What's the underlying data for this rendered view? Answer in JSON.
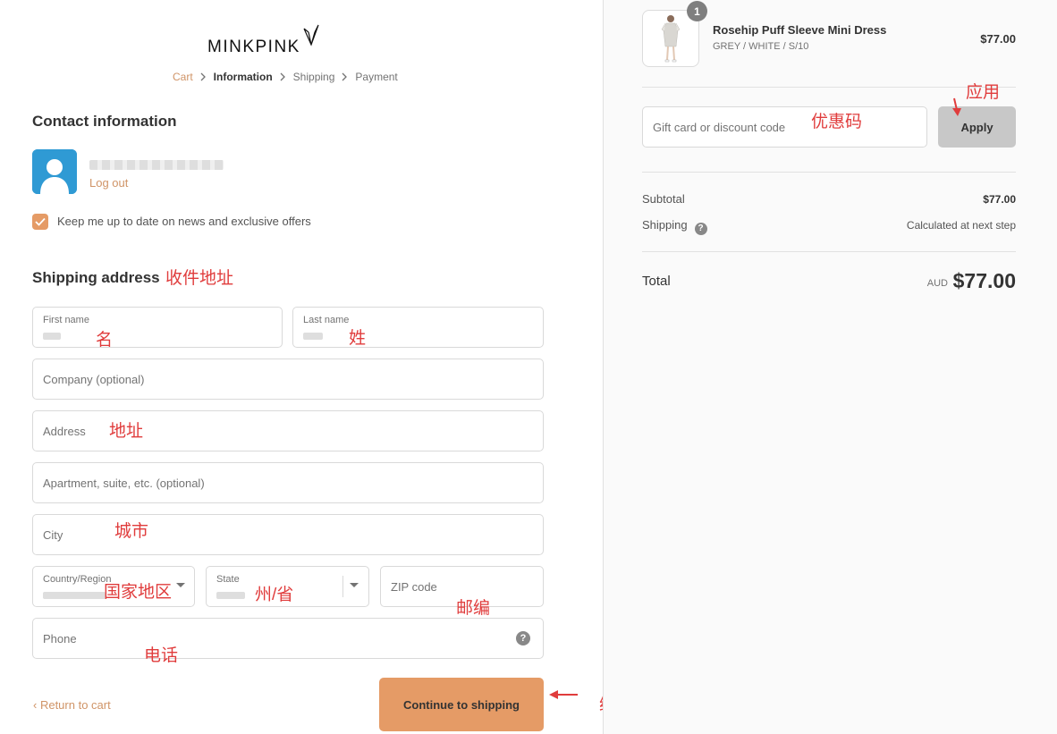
{
  "brand": {
    "name": "MINKPINK"
  },
  "breadcrumb": [
    {
      "label": "Cart"
    },
    {
      "label": "Information"
    },
    {
      "label": "Shipping"
    },
    {
      "label": "Payment"
    }
  ],
  "contact": {
    "title": "Contact information",
    "logout_label": "Log out",
    "newsletter_label": "Keep me up to date on news and exclusive offers",
    "newsletter_checked": true
  },
  "shipping": {
    "title": "Shipping address",
    "first_name_label": "First name",
    "last_name_label": "Last name",
    "company_placeholder": "Company (optional)",
    "address_placeholder": "Address",
    "apartment_placeholder": "Apartment, suite, etc. (optional)",
    "city_placeholder": "City",
    "country_label": "Country/Region",
    "state_label": "State",
    "zip_placeholder": "ZIP code",
    "phone_placeholder": "Phone"
  },
  "actions": {
    "return_label": "Return to cart",
    "continue_label": "Continue to shipping"
  },
  "annotations": {
    "shipping_address": "收件地址",
    "first_name": "名",
    "last_name": "姓",
    "address": "地址",
    "city": "城市",
    "country": "国家地区",
    "state": "州/省",
    "zip": "邮编",
    "phone": "电话",
    "continue": "继续",
    "discount": "优惠码",
    "apply": "应用"
  },
  "order": {
    "product": {
      "name": "Rosehip Puff Sleeve Mini Dress",
      "variant": "GREY / WHITE / S/10",
      "price": "$77.00",
      "quantity": "1"
    },
    "discount_placeholder": "Gift card or discount code",
    "apply_label": "Apply",
    "subtotal_label": "Subtotal",
    "subtotal_value": "$77.00",
    "shipping_label": "Shipping",
    "shipping_value": "Calculated at next step",
    "total_label": "Total",
    "currency": "AUD",
    "total_value": "$77.00"
  },
  "colors": {
    "accent": "#e59b66",
    "link": "#d09467",
    "annotation": "#e03c3c"
  }
}
